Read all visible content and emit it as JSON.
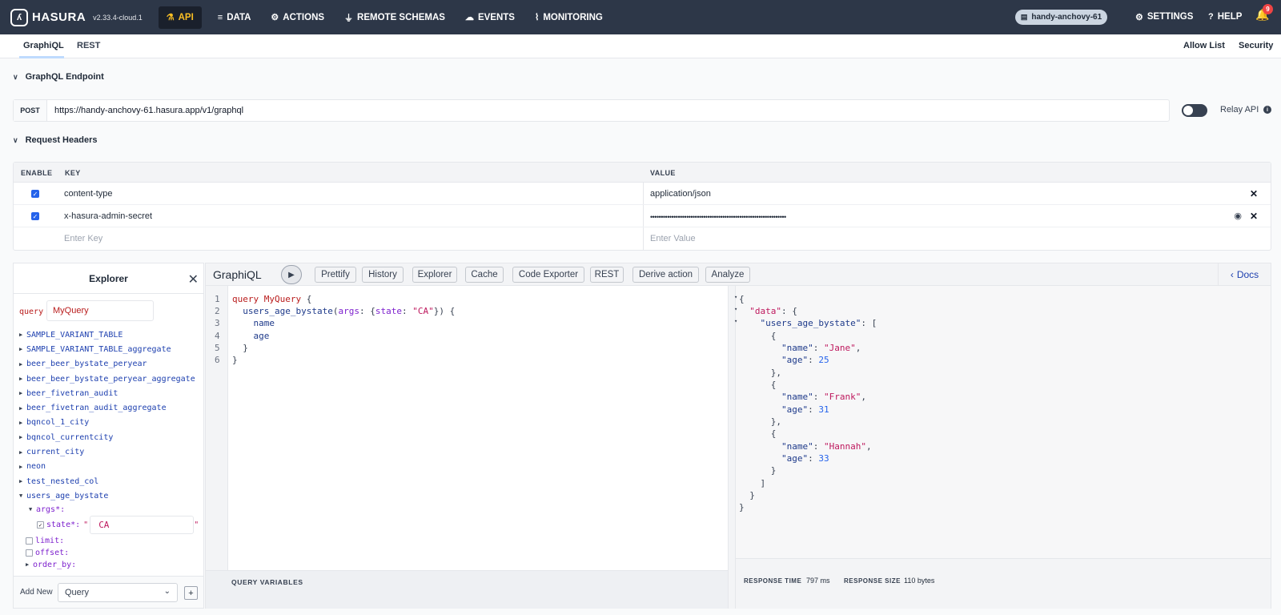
{
  "topbar": {
    "brand": "HASURA",
    "version": "v2.33.4-cloud.1",
    "nav": [
      {
        "label": "API",
        "icon": "flask-icon",
        "active": true
      },
      {
        "label": "DATA",
        "icon": "database-icon"
      },
      {
        "label": "ACTIONS",
        "icon": "actions-icon"
      },
      {
        "label": "REMOTE SCHEMAS",
        "icon": "plug-icon"
      },
      {
        "label": "EVENTS",
        "icon": "cloud-icon"
      },
      {
        "label": "MONITORING",
        "icon": "chart-icon"
      }
    ],
    "project": "handy-anchovy-61",
    "settings": "SETTINGS",
    "help": "HELP",
    "notifications": "9"
  },
  "subtabs": {
    "graphiql": "GraphiQL",
    "rest": "REST",
    "allow_list": "Allow List",
    "security": "Security"
  },
  "endpoint": {
    "section": "GraphQL Endpoint",
    "method": "POST",
    "url": "https://handy-anchovy-61.hasura.app/v1/graphql",
    "relay_label": "Relay API",
    "relay_enabled": false
  },
  "headers": {
    "section": "Request Headers",
    "columns": {
      "enable": "ENABLE",
      "key": "KEY",
      "value": "VALUE"
    },
    "rows": [
      {
        "enabled": true,
        "key": "content-type",
        "value": "application/json"
      },
      {
        "enabled": true,
        "key": "x-hasura-admin-secret",
        "value": "••••••••••••••••••••••••••••••••••••••••••••••••••••••••••••••••"
      }
    ],
    "key_placeholder": "Enter Key",
    "value_placeholder": "Enter Value"
  },
  "explorer": {
    "title": "Explorer",
    "query_keyword": "query",
    "query_name": "MyQuery",
    "items": [
      "SAMPLE_VARIANT_TABLE",
      "SAMPLE_VARIANT_TABLE_aggregate",
      "beer_beer_bystate_peryear",
      "beer_beer_bystate_peryear_aggregate",
      "beer_fivetran_audit",
      "beer_fivetran_audit_aggregate",
      "bqncol_1_city",
      "bqncol_currentcity",
      "current_city",
      "neon",
      "test_nested_col",
      "users_age_bystate"
    ],
    "args_label": "args*:",
    "state_label": "state*:",
    "state_quote": "\"",
    "state_value": "CA",
    "limit_label": "limit:",
    "offset_label": "offset:",
    "order_by_label": "order_by:",
    "add_new_label": "Add New",
    "add_new_value": "Query",
    "add_button": "+"
  },
  "graphiql": {
    "title": "GraphiQL",
    "buttons": [
      "Prettify",
      "History",
      "Explorer",
      "Cache",
      "Code Exporter",
      "REST",
      "Derive action",
      "Analyze"
    ],
    "docs": "Docs",
    "line_numbers": [
      "1",
      "2",
      "3",
      "4",
      "5",
      "6"
    ],
    "query": {
      "keyword": "query",
      "name": "MyQuery",
      "field": "users_age_bystate",
      "arg_name": "args",
      "arg_key": "state",
      "arg_value": "\"CA\"",
      "sel1": "name",
      "sel2": "age"
    },
    "query_variables": "QUERY VARIABLES",
    "result": {
      "data_key": "\"data\"",
      "root_key": "\"users_age_bystate\"",
      "name_key": "\"name\"",
      "age_key": "\"age\"",
      "rows": [
        {
          "name": "\"Jane\"",
          "age": "25"
        },
        {
          "name": "\"Frank\"",
          "age": "31"
        },
        {
          "name": "\"Hannah\"",
          "age": "33"
        }
      ]
    },
    "response_time_label": "RESPONSE TIME",
    "response_time": "797 ms",
    "response_size_label": "RESPONSE SIZE",
    "response_size": "110 bytes"
  }
}
